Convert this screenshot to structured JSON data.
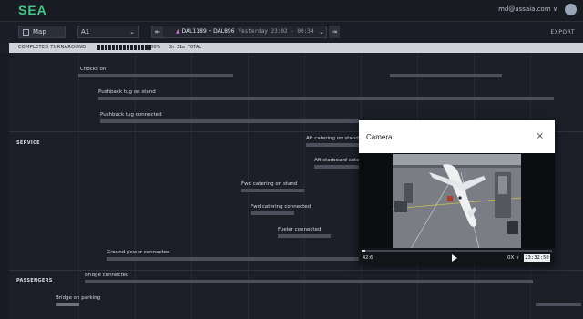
{
  "app": {
    "logo": "SEA",
    "user": "md@assaia.com ∨"
  },
  "toolbar": {
    "map_label": "Map",
    "gate": "A1",
    "flight_arrival": "DAL1189",
    "flight_departure": "DAL896",
    "flight_sep": "•",
    "flight_when": "Yesterday 23:02 - 00:34",
    "export_label": "EXPORT"
  },
  "progress": {
    "label": "COMPLETED TURNAROUND:",
    "percent": "100%",
    "total": "0h 31m TOTAL",
    "cells": 15
  },
  "sections": {
    "service": "SERVICE",
    "passengers": "PASSENGERS"
  },
  "events": [
    {
      "label": "Chocks on"
    },
    {
      "label": "Pushback tug on stand"
    },
    {
      "label": "Pushback tug connected"
    },
    {
      "label": "Aft catering on stand"
    },
    {
      "label": "Aft starboard cater"
    },
    {
      "label": "Fwd catering on stand"
    },
    {
      "label": "Fwd catering connected"
    },
    {
      "label": "Fueler connected"
    },
    {
      "label": "Ground power connected"
    },
    {
      "label": "Bridge connected"
    },
    {
      "label": "Bridge on parking"
    }
  ],
  "camera": {
    "title": "Camera",
    "close": "×",
    "current_time": "42:6",
    "speed": "0X ∨",
    "clock": "23:32:50"
  },
  "icons": {
    "map": "map-icon",
    "close": "close-icon",
    "play": "play-icon",
    "prev": "skip-back-icon",
    "next": "skip-forward-icon",
    "forward": "jump-forward-icon"
  },
  "colors": {
    "brand": "#3ec98a",
    "background": "#1c1f28",
    "bar": "#4b505c",
    "progress_bg": "#cfd2d8"
  }
}
